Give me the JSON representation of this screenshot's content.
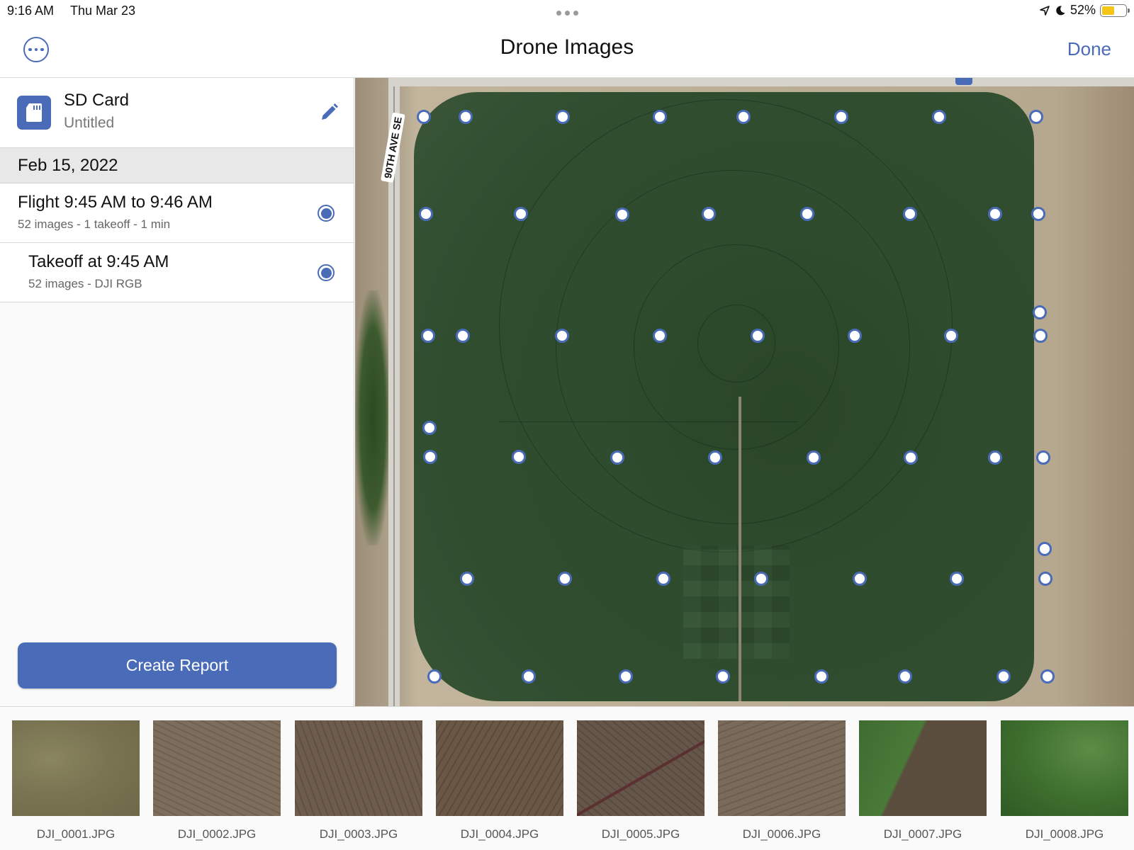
{
  "status_bar": {
    "time": "9:16 AM",
    "date": "Thu Mar 23",
    "battery": "52%",
    "battery_level": 0.52
  },
  "nav": {
    "title": "Drone Images",
    "done_label": "Done"
  },
  "source": {
    "title": "SD Card",
    "subtitle": "Untitled"
  },
  "date_header": "Feb 15, 2022",
  "flight": {
    "title": "Flight 9:45 AM to 9:46 AM",
    "subtitle": "52 images - 1 takeoff - 1 min"
  },
  "takeoff": {
    "title": "Takeoff at 9:45 AM",
    "subtitle": "52 images - DJI RGB"
  },
  "create_report_label": "Create Report",
  "map": {
    "road_label": "90TH AVE SE"
  },
  "thumbnails": [
    {
      "name": "DJI_0001.JPG"
    },
    {
      "name": "DJI_0002.JPG"
    },
    {
      "name": "DJI_0003.JPG"
    },
    {
      "name": "DJI_0004.JPG"
    },
    {
      "name": "DJI_0005.JPG"
    },
    {
      "name": "DJI_0006.JPG"
    },
    {
      "name": "DJI_0007.JPG"
    },
    {
      "name": "DJI_0008.JPG"
    }
  ],
  "colors": {
    "accent": "#4a6cb8",
    "battery": "#f5c518"
  }
}
